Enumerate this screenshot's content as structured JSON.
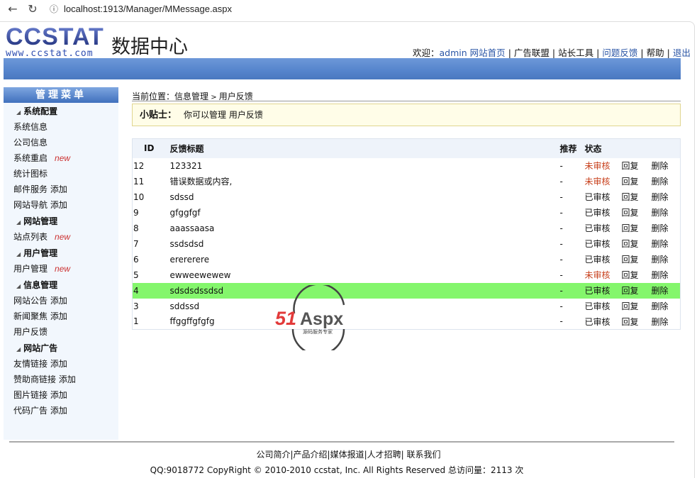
{
  "browser": {
    "url": "localhost:1913/Manager/MMessage.aspx"
  },
  "header": {
    "logo_text": "CCSTAT",
    "logo_url_text": "www.ccstat.com",
    "site_name": "数据中心",
    "welcome": "欢迎：",
    "user": "admin",
    "links": [
      "网站首页",
      "广告联盟",
      "站长工具",
      "问题反馈",
      "帮助",
      "退出"
    ],
    "sep": "|"
  },
  "sidebar": {
    "title": "管理菜单",
    "groups": [
      {
        "label": "系统配置",
        "items": [
          {
            "label": "系统信息"
          },
          {
            "label": "公司信息"
          },
          {
            "label": "系统重启",
            "badge": "new"
          },
          {
            "label": "统计图标"
          },
          {
            "label": "邮件服务 添加"
          },
          {
            "label": "网站导航 添加"
          }
        ]
      },
      {
        "label": "网站管理",
        "items": [
          {
            "label": "站点列表",
            "badge": "new"
          }
        ]
      },
      {
        "label": "用户管理",
        "items": [
          {
            "label": "用户管理",
            "badge": "new"
          }
        ]
      },
      {
        "label": "信息管理",
        "items": [
          {
            "label": "网站公告 添加"
          },
          {
            "label": "新闻聚焦 添加"
          },
          {
            "label": "用户反馈"
          }
        ]
      },
      {
        "label": "网站广告",
        "items": [
          {
            "label": "友情链接 添加"
          },
          {
            "label": "赞助商链接 添加"
          },
          {
            "label": "图片链接 添加"
          },
          {
            "label": "代码广告 添加"
          }
        ]
      }
    ]
  },
  "breadcrumb": {
    "prefix": "当前位置：",
    "section": "信息管理",
    "sep": " > ",
    "page": "用户反馈"
  },
  "tip": {
    "label": "小贴士：",
    "text": "你可以管理 用户反馈"
  },
  "table": {
    "headers": {
      "id": "ID",
      "title": "反馈标题",
      "recommend": "推荐",
      "status": "状态"
    },
    "reply_label": "回复",
    "delete_label": "删除",
    "rows": [
      {
        "id": "12",
        "title": "123321",
        "recommend": "-",
        "status": "未审核",
        "pending": true
      },
      {
        "id": "11",
        "title": "错误数据或内容,",
        "recommend": "-",
        "status": "未审核",
        "pending": true
      },
      {
        "id": "10",
        "title": "sdssd",
        "recommend": "-",
        "status": "已审核"
      },
      {
        "id": "9",
        "title": "gfggfgf",
        "recommend": "-",
        "status": "已审核"
      },
      {
        "id": "8",
        "title": "aaassaasa",
        "recommend": "-",
        "status": "已审核"
      },
      {
        "id": "7",
        "title": "ssdsdsd",
        "recommend": "-",
        "status": "已审核"
      },
      {
        "id": "6",
        "title": "erererere",
        "recommend": "-",
        "status": "已审核"
      },
      {
        "id": "5",
        "title": "ewweewewew",
        "recommend": "-",
        "status": "未审核",
        "pending": true
      },
      {
        "id": "4",
        "title": "sdsdsdssdsd",
        "recommend": "-",
        "status": "已审核",
        "highlight": true
      },
      {
        "id": "3",
        "title": "sddssd",
        "recommend": "-",
        "status": "已审核"
      },
      {
        "id": "1",
        "title": "ffggffgfgfg",
        "recommend": "-",
        "status": "已审核"
      }
    ]
  },
  "footer": {
    "links": [
      "公司简介",
      "产品介绍",
      "媒体报道",
      "人才招聘",
      "联系我们"
    ],
    "copyright": "QQ:9018772 CopyRight © 2010-2010 ccstat, Inc. All Rights Reserved 总访问量：2113 次"
  },
  "watermark": {
    "text": "51Aspx",
    "subtitle": "源码服务专家"
  },
  "colors": {
    "band": "#5584cc",
    "highlight": "#84f66c",
    "pending": "#c8401c",
    "link": "#2a55a5"
  }
}
